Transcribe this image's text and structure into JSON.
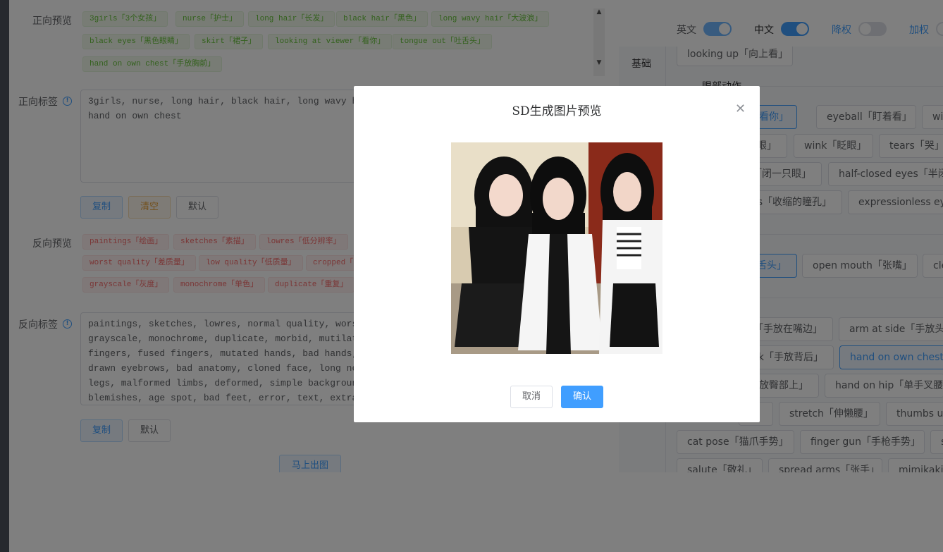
{
  "left": {
    "positive_preview_label": "正向预览",
    "positive_tags": [
      "3girls「3个女孩」",
      "nurse「护士」",
      "long hair「长发」",
      "black hair「黑色」",
      "long wavy hair「大波浪」",
      "black eyes「黑色眼睛」",
      "skirt「裙子」",
      "looking at viewer「看你」",
      "tongue out「吐舌头」",
      "hand on own chest「手放胸前」"
    ],
    "positive_label": "正向标签",
    "positive_text": "3girls, nurse, long hair, black hair, long wavy hair,\nhand on own chest",
    "positive_buttons": {
      "copy": "复制",
      "clear": "清空",
      "default": "默认"
    },
    "negative_preview_label": "反向预览",
    "negative_tags": [
      "paintings「绘画」",
      "sketches「素描」",
      "lowres「低分辨率」",
      "worst quality「差质量」",
      "low quality「低质量」",
      "cropped「",
      "grayscale「灰度」",
      "monochrome「单色」",
      "duplicate「重复」"
    ],
    "negative_label": "反向标签",
    "negative_text": "paintings, sketches, lowres, normal quality, worst qua\ngrayscale, monochrome, duplicate, morbid, mutilated, m\nfingers, fused fingers, mutated hands, bad hands, poor\ndrawn eyebrows, bad anatomy, cloned face, long neck, e\nlegs, malformed limbs, deformed, simple background, ba\nblemishes, age spot, bad feet, error, text, extra digi",
    "negative_buttons": {
      "copy": "复制",
      "default": "默认"
    },
    "generate_button": "马上出图"
  },
  "right": {
    "toggles": [
      {
        "label": "英文",
        "on": true
      },
      {
        "label": "中文",
        "on": true
      },
      {
        "label": "降权",
        "on": false
      },
      {
        "label": "加权",
        "on": false
      }
    ],
    "category": "基础",
    "section_eye": "眼部动作",
    "tags": [
      {
        "text": "looking up「向上看」",
        "active": false
      },
      {
        "text": "「看你」",
        "active": true
      },
      {
        "text": "eyeball「盯着看」",
        "active": false
      },
      {
        "text": "wid",
        "active": false
      },
      {
        "text": "眼」",
        "active": false
      },
      {
        "text": "wink「眨眼」",
        "active": false
      },
      {
        "text": "tears「哭」",
        "active": false
      },
      {
        "text": "「闭一只眼」",
        "active": false
      },
      {
        "text": "half-closed eyes「半闭眼",
        "active": false
      },
      {
        "text": "s「收缩的瞳孔」",
        "active": false
      },
      {
        "text": "expressionless eyes",
        "active": false
      },
      {
        "text": "舌头」",
        "active": true
      },
      {
        "text": "open mouth「张嘴」",
        "active": false
      },
      {
        "text": "cle",
        "active": false
      },
      {
        "text": "「手放在嘴边」",
        "active": false
      },
      {
        "text": "arm at side「手放头旁",
        "active": false
      },
      {
        "text": "k「手放背后」",
        "active": false
      },
      {
        "text": "hand on own chest「",
        "active": true
      },
      {
        "text": "放臀部上」",
        "active": false
      },
      {
        "text": "hand on hip「单手叉腰」",
        "active": false
      },
      {
        "text": "",
        "active": false
      },
      {
        "text": "stretch「伸懒腰」",
        "active": false
      },
      {
        "text": "thumbs up",
        "active": false
      },
      {
        "text": "cat pose「猫爪手势」",
        "active": false
      },
      {
        "text": "finger gun「手枪手势」",
        "active": false
      },
      {
        "text": "s",
        "active": false
      },
      {
        "text": "salute「敬礼」",
        "active": false
      },
      {
        "text": "spread arms「张手」",
        "active": false
      },
      {
        "text": "mimikaki「",
        "active": false
      }
    ]
  },
  "modal": {
    "title": "SD生成图片预览",
    "image_alt": "three girls in black dresses and white coats",
    "cancel": "取消",
    "confirm": "确认"
  },
  "colors": {
    "primary": "#409eff",
    "success": "#67c23a",
    "danger": "#f56c6c",
    "warning": "#e6a23c"
  }
}
